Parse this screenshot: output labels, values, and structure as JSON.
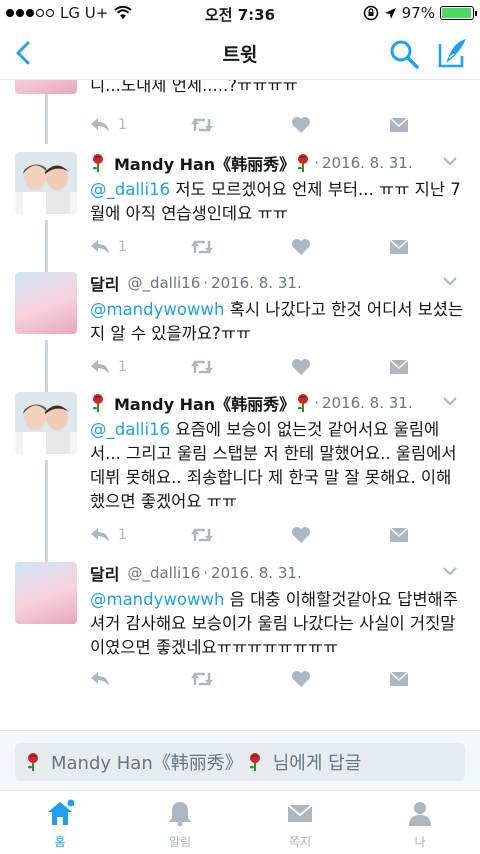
{
  "status_bar": {
    "carrier": "LG U+",
    "time": "오전 7:36",
    "battery": "97%",
    "battery_level": 0.97
  },
  "nav": {
    "title": "트윗"
  },
  "colors": {
    "accent": "#1da1f2",
    "muted": "#aab8c2",
    "text": "#14171a",
    "secondary": "#657786"
  },
  "tweets": [
    {
      "partial_text": "니...노내제 언세.....?ㅠㅠㅠㅠ",
      "reply_count": "1"
    },
    {
      "name": "Mandy Han《韩丽秀》",
      "handle": "",
      "date": "2016. 8. 31.",
      "mention": "@_dalli16",
      "text": " 저도 모르겠어요 언제 부터... ㅠㅠ 지난 7월에 아직 연습생인데요 ㅠㅠ",
      "reply_count": "1"
    },
    {
      "name": "달리",
      "handle": "@_dalli16",
      "date": "2016. 8. 31.",
      "mention": "@mandywowwh",
      "text": " 혹시 나갔다고 한것 어디서 보셨는지 알 수 있을까요?ㅠㅠ",
      "reply_count": "1"
    },
    {
      "name": "Mandy Han《韩丽秀》",
      "handle": "",
      "date": "2016. 8. 31.",
      "mention": "@_dalli16",
      "text": " 요즘에 보승이 없는것 같어서요 울림에서... 그리고 울림 스탭분 저 한테 말했어요.. 울림에서 데뷔 못해요.. 죄송합니다 제 한국 말 잘 못해요. 이해했으면 좋겠어요 ㅠㅠ",
      "reply_count": "1"
    },
    {
      "name": "달리",
      "handle": "@_dalli16",
      "date": "2016. 8. 31.",
      "mention": "@mandywowwh",
      "text": " 음 대충 이해할것같아요 답변해주셔거 감사해요 보승이가 울림 나갔다는 사실이 거짓말이였으면 좋겠네요ㅠㅠㅠㅠㅠㅠㅠㅠ",
      "reply_count": ""
    }
  ],
  "reply_bar": {
    "name": "Mandy Han《韩丽秀》",
    "suffix": "님에게 답글"
  },
  "tabs": [
    {
      "label": "홈",
      "icon": "home-icon",
      "active": true
    },
    {
      "label": "알림",
      "icon": "bell-icon",
      "active": false
    },
    {
      "label": "쪽지",
      "icon": "envelope-icon",
      "active": false
    },
    {
      "label": "나",
      "icon": "profile-icon",
      "active": false
    }
  ]
}
